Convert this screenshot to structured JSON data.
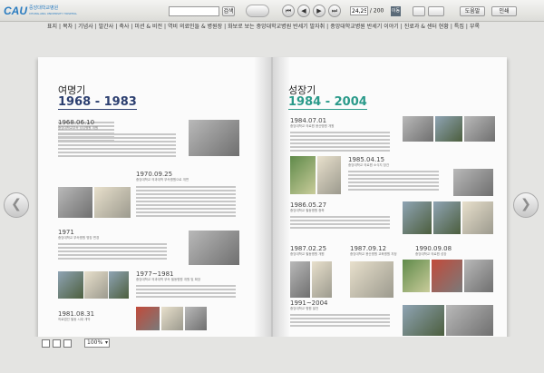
{
  "toolbar": {
    "logo_mark": "CAU",
    "logo_text_1": "중앙대학교병원",
    "logo_text_2": "CHUNG-ANG UNIVERSITY HOSPITAL",
    "search_button": "검색",
    "current_page": "24,25",
    "page_separator": "/",
    "total_pages": "200",
    "go_button": "이동",
    "help_button": "도움말",
    "print_button": "인쇄",
    "nav_first": "⏮",
    "nav_prev": "◀",
    "nav_next": "▶",
    "nav_last": "⏭"
  },
  "menu": [
    "표지",
    "목차",
    "기념사",
    "발간사",
    "축사",
    "미션 & 비전",
    "역비 의료인들 & 병원장",
    "화보로 보는 중앙대학교병원 반세기 발자취",
    "중앙대학교병원 반세기 이야기",
    "진료과 & 센터 현황",
    "특집",
    "부록"
  ],
  "left_page": {
    "era_title": "여명기",
    "era_years": "1968 - 1983",
    "events": [
      {
        "year": "1968.06.10",
        "caption": "중앙대학교부속 성심병원 개원"
      },
      {
        "year": "1970.09.25",
        "caption": "중앙대학교 의과대학 부속병원으로 개편"
      },
      {
        "year": "1971",
        "caption": "중앙대학교 부속병원 명칭 변경"
      },
      {
        "year": "1977~1981",
        "caption": "중앙대학교 의과대학 부속 필동병원 개원 및 확장"
      },
      {
        "year": "1981.08.31",
        "caption": "의료법인 필동 시대 개막"
      }
    ]
  },
  "right_page": {
    "era_title": "성장기",
    "era_years": "1984 - 2004",
    "events": [
      {
        "year": "1984.07.01",
        "caption": "중앙대학교 의료원 용산병원 개원"
      },
      {
        "year": "1985.04.15",
        "caption": "중앙대학교 의료원 소식지 창간"
      },
      {
        "year": "1986.05.27",
        "caption": "중앙대학교 필동병원 증축"
      },
      {
        "year": "1987.02.25",
        "caption": "중앙대학교 필동병원 개원"
      },
      {
        "year": "1987.09.12",
        "caption": "중앙대학교 용산병원 교육병원 지정"
      },
      {
        "year": "1990.09.08",
        "caption": "중앙대학교 의료원 성장"
      },
      {
        "year": "1991~2004",
        "caption": "중앙대학교 병원 발전"
      }
    ]
  },
  "status": {
    "zoom": "100%"
  }
}
